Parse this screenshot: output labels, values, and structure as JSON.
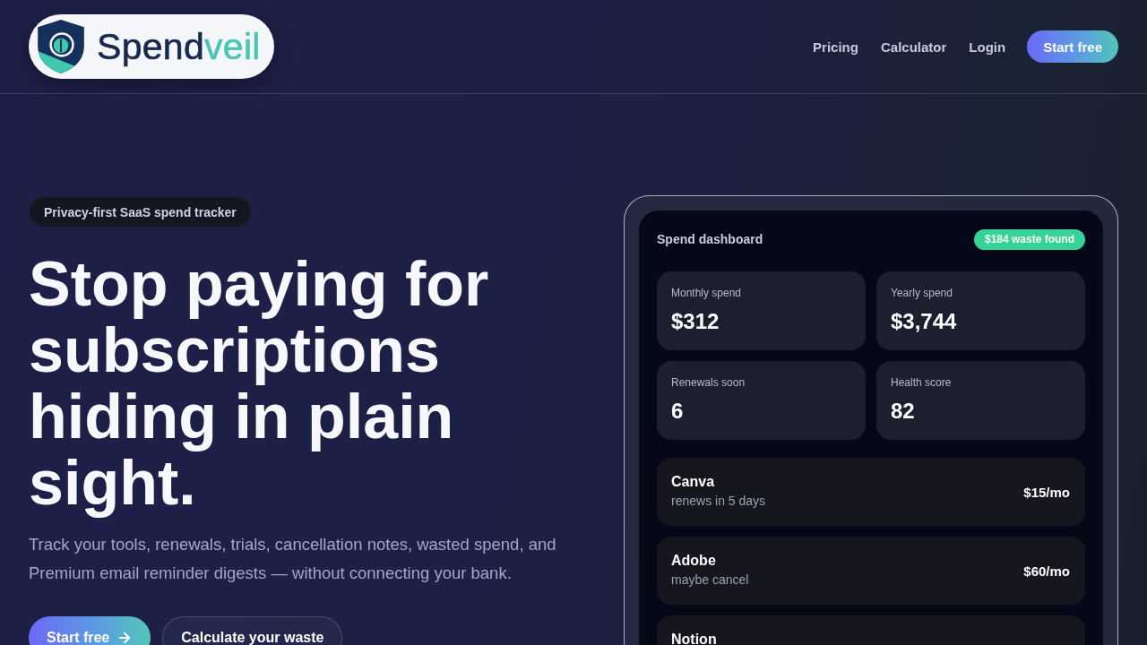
{
  "header": {
    "logo": {
      "name": "Spend",
      "accent": "veil"
    },
    "nav_links": [
      "Pricing",
      "Calculator",
      "Login"
    ],
    "cta": "Start free"
  },
  "hero": {
    "badge": "Privacy-first SaaS spend tracker",
    "headline": "Stop paying for subscriptions hiding in plain sight.",
    "description": "Track your tools, renewals, trials, cancellation notes, wasted spend, and Premium email reminder digests — without connecting your bank.",
    "buttons": [
      {
        "label": "Start free",
        "kind": "primary"
      },
      {
        "label": "Calculate your waste",
        "kind": "secondary"
      }
    ]
  },
  "dashboard": {
    "title": "Spend dashboard",
    "badge": "$184 waste found",
    "stats": [
      {
        "label": "Monthly spend",
        "value": "$312"
      },
      {
        "label": "Yearly spend",
        "value": "$3,744"
      },
      {
        "label": "Renewals soon",
        "value": "6"
      },
      {
        "label": "Health score",
        "value": "82"
      }
    ],
    "subscriptions": [
      {
        "name": "Canva",
        "note": "renews in 5 days",
        "price": "$15/mo"
      },
      {
        "name": "Adobe",
        "note": "maybe cancel",
        "price": "$60/mo"
      },
      {
        "name": "Notion"
      }
    ]
  }
}
